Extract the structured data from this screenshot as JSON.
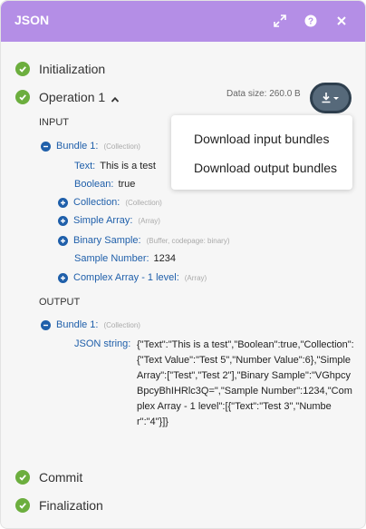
{
  "header": {
    "title": "JSON",
    "icons": [
      "expand-icon",
      "help-icon",
      "close-icon"
    ]
  },
  "steps": {
    "initialization": "Initialization",
    "operation": "Operation 1",
    "commit": "Commit",
    "finalization": "Finalization"
  },
  "data_size": "Data size: 260.0 B",
  "menu": {
    "download_input": "Download input bundles",
    "download_output": "Download output bundles"
  },
  "input": {
    "label": "INPUT",
    "bundle_label": "Bundle 1:",
    "bundle_type": "(Collection)",
    "text_key": "Text:",
    "text_val": "This is a test",
    "boolean_key": "Boolean:",
    "boolean_val": "true",
    "collection_key": "Collection:",
    "collection_type": "(Collection)",
    "simple_array_key": "Simple Array:",
    "simple_array_type": "(Array)",
    "binary_key": "Binary Sample:",
    "binary_type": "(Buffer, codepage: binary)",
    "number_key": "Sample Number:",
    "number_val": "1234",
    "complex_key": "Complex Array - 1 level:",
    "complex_type": "(Array)"
  },
  "output": {
    "label": "OUTPUT",
    "bundle_label": "Bundle 1:",
    "bundle_type": "(Collection)",
    "json_key": "JSON string:",
    "json_val": "{\"Text\":\"This is a test\",\"Boolean\":true,\"Collection\":{\"Text Value\":\"Test 5\",\"Number Value\":6},\"Simple Array\":[\"Test\",\"Test 2\"],\"Binary Sample\":\"VGhpcyBpcyBhIHRlc3Q=\",\"Sample Number\":1234,\"Complex Array - 1 level\":[{\"Text\":\"Test 3\",\"Number\":\"4\"}]}"
  },
  "colors": {
    "header": "#b48ee6",
    "success": "#6cae3e",
    "link": "#1f5faa",
    "button": "#56697a"
  }
}
